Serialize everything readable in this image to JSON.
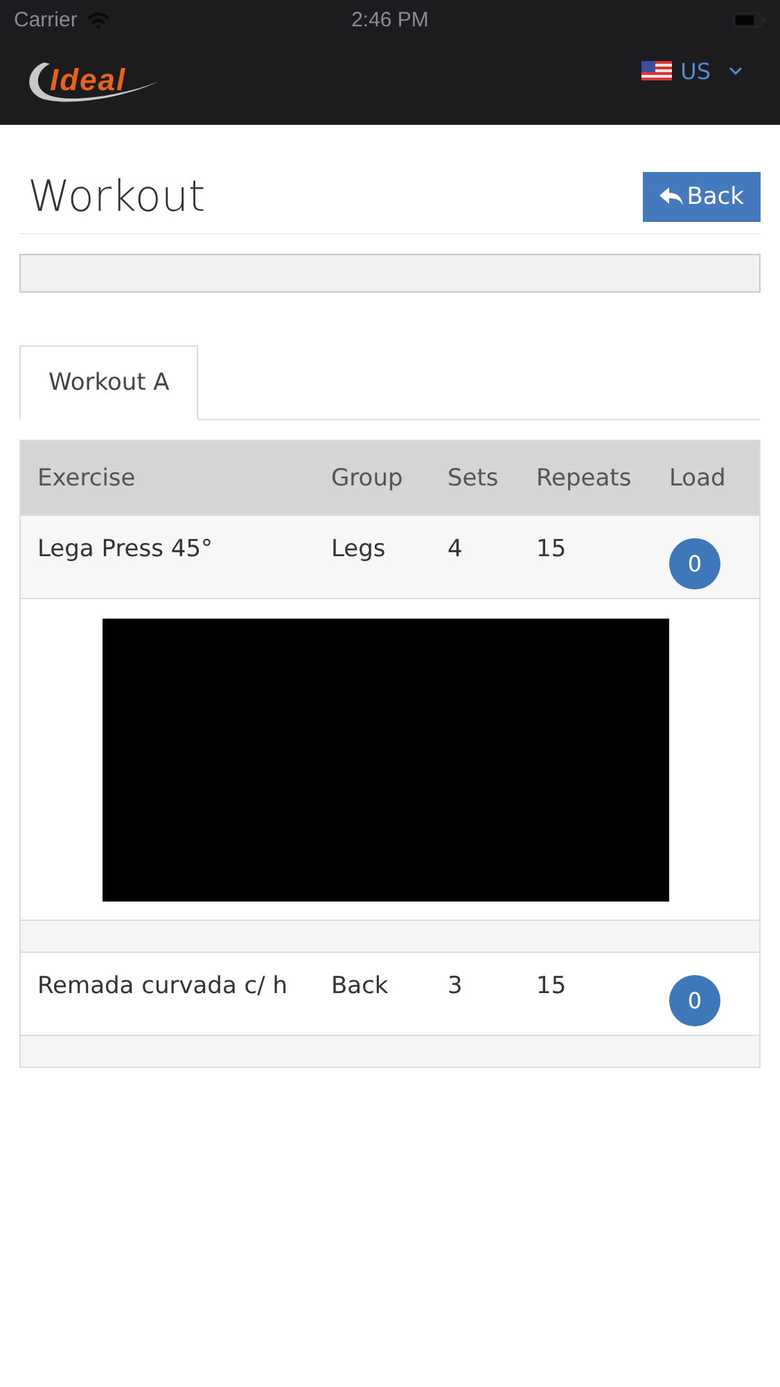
{
  "status_bar": {
    "carrier": "Carrier",
    "time": "2:46 PM"
  },
  "navbar": {
    "logo": "Ideal",
    "language": "US"
  },
  "page": {
    "title": "Workout",
    "back_button": "Back"
  },
  "tabs": [
    {
      "label": "Workout A",
      "selected": true
    }
  ],
  "table": {
    "columns": [
      "Exercise",
      "Group",
      "Sets",
      "Repeats",
      "Load"
    ],
    "rows": [
      {
        "kind": "exercise",
        "exercise": "Lega Press 45°",
        "group": "Legs",
        "sets": "4",
        "repeats": "15",
        "load": "0"
      },
      {
        "kind": "video"
      },
      {
        "kind": "spacer"
      },
      {
        "kind": "exercise",
        "exercise": "Remada curvada c/ h",
        "group": "Back",
        "sets": "3",
        "repeats": "15",
        "load": "0"
      },
      {
        "kind": "spacer"
      }
    ]
  }
}
